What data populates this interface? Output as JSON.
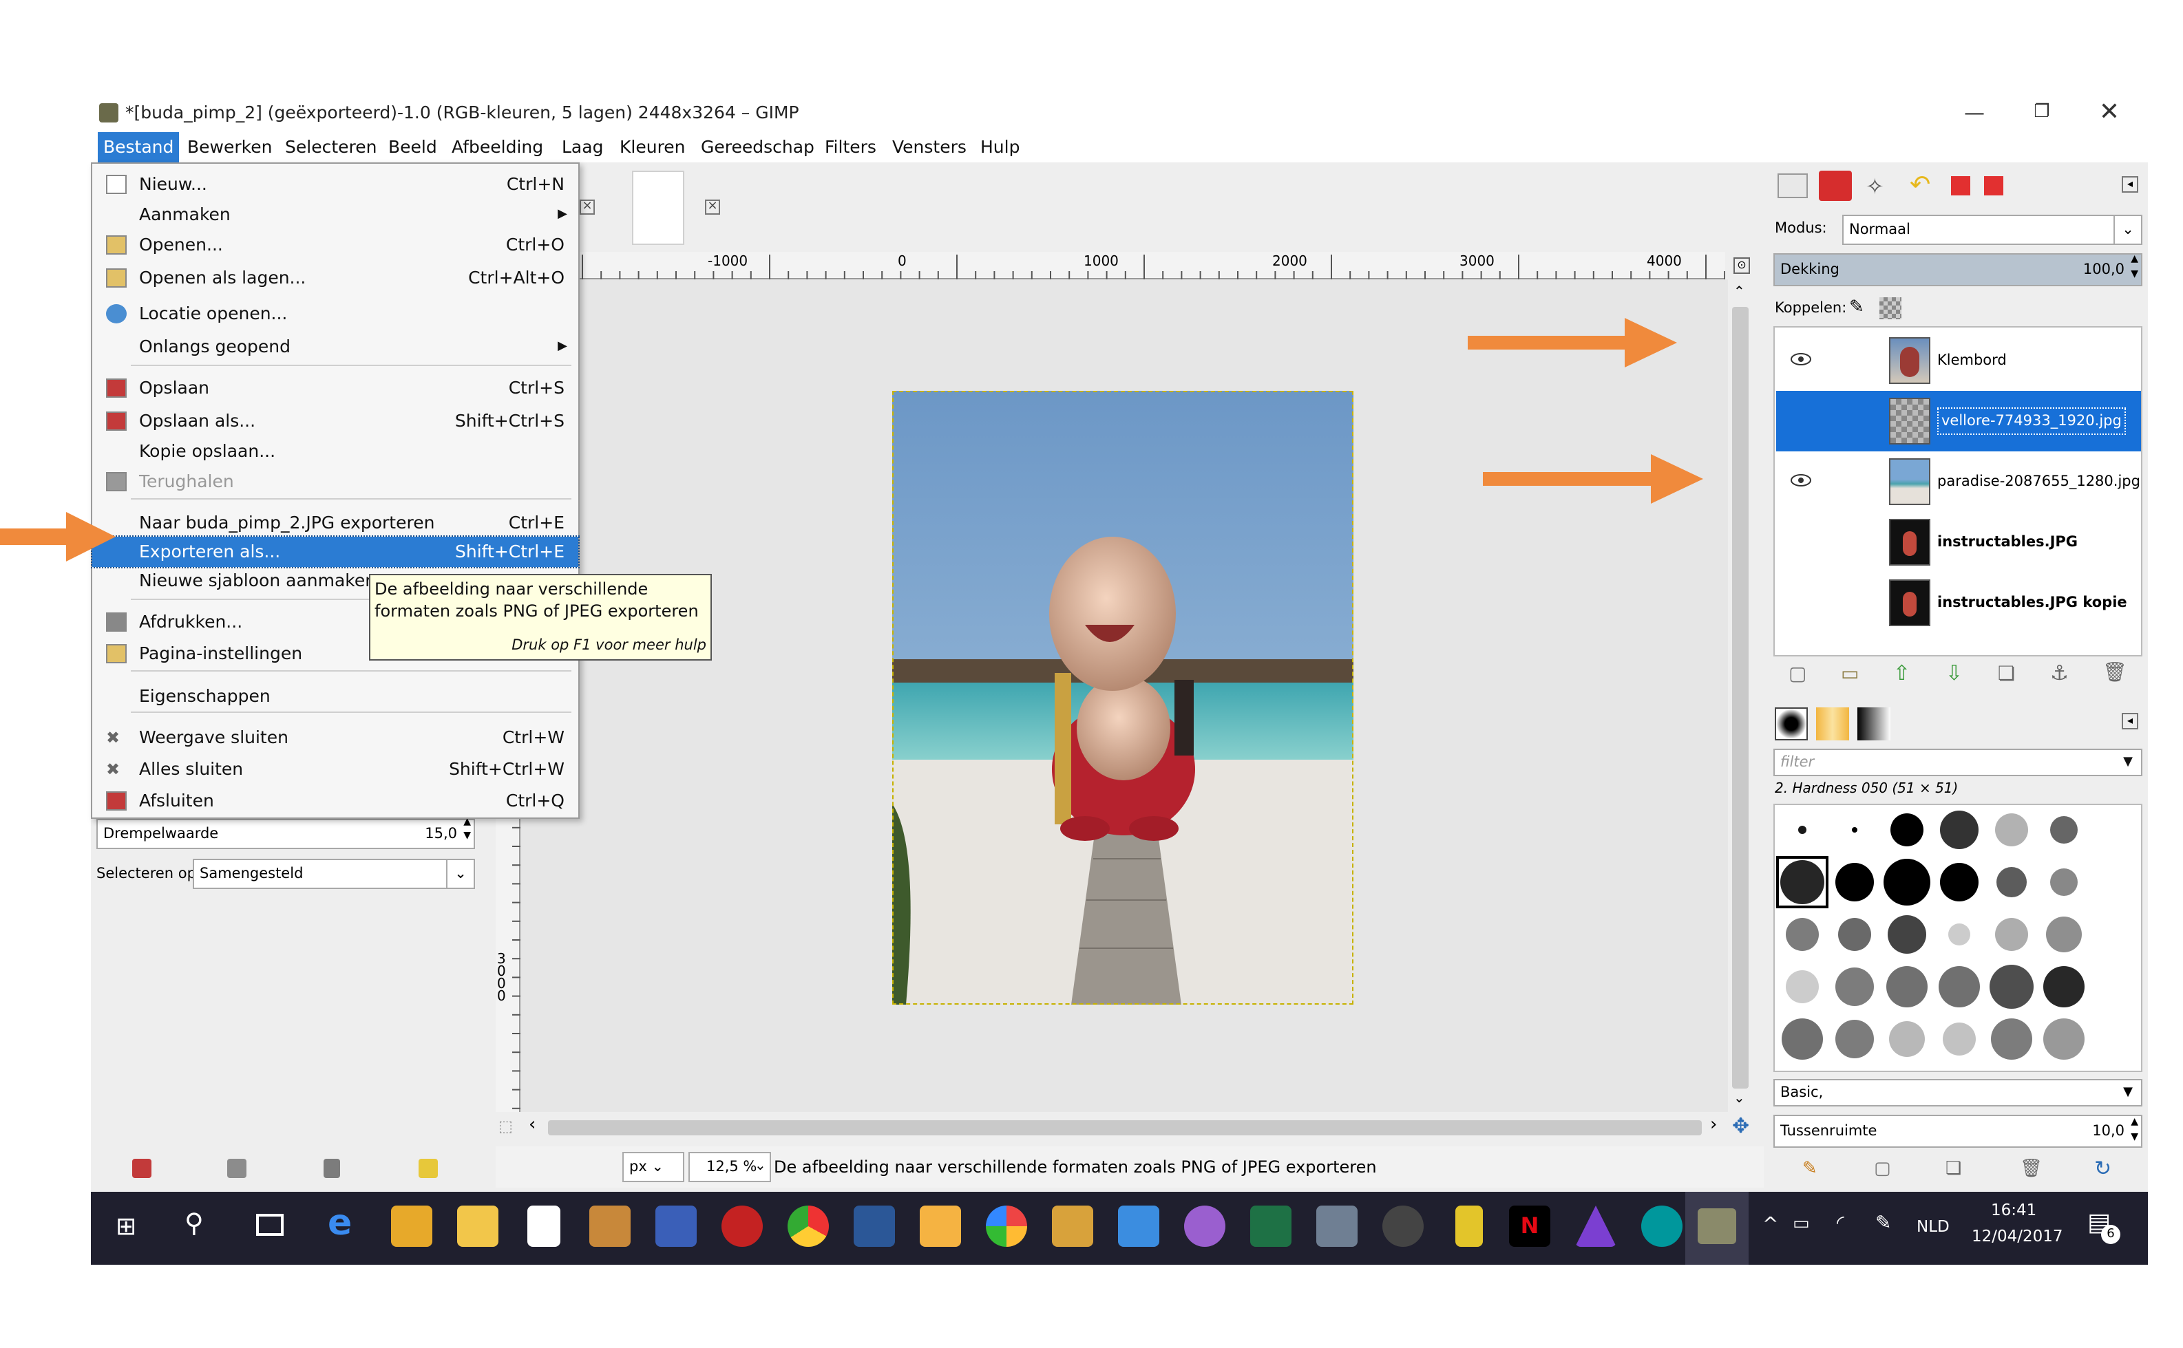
{
  "window": {
    "title": "*[buda_pimp_2] (geëxporteerd)-1.0 (RGB-kleuren, 5 lagen) 2448x3264 – GIMP",
    "minimize_icon": "minimize-icon",
    "maximize_icon": "restore-icon",
    "close_icon": "close-icon"
  },
  "menubar": [
    "Bestand",
    "Bewerken",
    "Selecteren",
    "Beeld",
    "Afbeelding",
    "Laag",
    "Kleuren",
    "Gereedschap",
    "Filters",
    "Vensters",
    "Hulp"
  ],
  "file_menu": [
    {
      "label": "Nieuw...",
      "shortcut": "Ctrl+N",
      "icon": "new-document-icon"
    },
    {
      "label": "Aanmaken",
      "shortcut": "",
      "icon": "",
      "submenu": true
    },
    {
      "label": "Openen...",
      "shortcut": "Ctrl+O",
      "icon": "folder-icon"
    },
    {
      "label": "Openen als lagen...",
      "shortcut": "Ctrl+Alt+O",
      "icon": "open-layers-icon"
    },
    {
      "label": "Locatie openen...",
      "shortcut": "",
      "icon": "globe-icon"
    },
    {
      "label": "Onlangs geopend",
      "shortcut": "",
      "icon": "",
      "submenu": true
    },
    {
      "label": "Opslaan",
      "shortcut": "Ctrl+S",
      "icon": "save-icon"
    },
    {
      "label": "Opslaan als...",
      "shortcut": "Shift+Ctrl+S",
      "icon": "save-as-icon"
    },
    {
      "label": "Kopie opslaan...",
      "shortcut": "",
      "icon": ""
    },
    {
      "label": "Terughalen",
      "shortcut": "",
      "icon": "revert-icon",
      "disabled": true
    },
    {
      "label": "Naar buda_pimp_2.JPG exporteren",
      "shortcut": "Ctrl+E",
      "icon": ""
    },
    {
      "label": "Exporteren als...",
      "shortcut": "Shift+Ctrl+E",
      "icon": "",
      "selected": true
    },
    {
      "label": "Nieuwe sjabloon aanmaken...",
      "shortcut": "",
      "icon": ""
    },
    {
      "label": "Afdrukken...",
      "shortcut": "",
      "icon": "printer-icon"
    },
    {
      "label": "Pagina-instellingen",
      "shortcut": "",
      "icon": "page-setup-icon"
    },
    {
      "label": "Eigenschappen",
      "shortcut": "",
      "icon": ""
    },
    {
      "label": "Weergave sluiten",
      "shortcut": "Ctrl+W",
      "icon": "close-x-icon"
    },
    {
      "label": "Alles sluiten",
      "shortcut": "Shift+Ctrl+W",
      "icon": "close-x-icon"
    },
    {
      "label": "Afsluiten",
      "shortcut": "Ctrl+Q",
      "icon": "quit-icon"
    }
  ],
  "tooltip": {
    "text": "De afbeelding naar verschillende formaten zoals PNG of JPEG exporteren",
    "hint": "Druk op F1 voor meer hulp"
  },
  "tool_options": {
    "threshold_label": "Drempelwaarde",
    "threshold_value": "15,0",
    "select_by_label": "Selecteren op:",
    "select_by_value": "Samengesteld"
  },
  "ruler": {
    "h_labels": [
      "-1000",
      "0",
      "1000",
      "2000",
      "3000",
      "4000"
    ],
    "v_label": "3000"
  },
  "statusbar": {
    "unit": "px",
    "zoom": "12,5 %",
    "message": "De afbeelding naar verschillende formaten zoals PNG of JPEG exporteren"
  },
  "layers_panel": {
    "mode_label": "Modus:",
    "mode_value": "Normaal",
    "opacity_label": "Dekking",
    "opacity_value": "100,0",
    "lock_label": "Koppelen:",
    "layers": [
      {
        "name": "Klembord",
        "visible": true,
        "selected": false,
        "bold": false
      },
      {
        "name": "vellore-774933_1920.jpg",
        "visible": false,
        "selected": true,
        "bold": false
      },
      {
        "name": "paradise-2087655_1280.jpg",
        "visible": true,
        "selected": false,
        "bold": false
      },
      {
        "name": "instructables.JPG",
        "visible": false,
        "selected": false,
        "bold": true
      },
      {
        "name": "instructables.JPG kopie",
        "visible": false,
        "selected": false,
        "bold": true
      }
    ]
  },
  "brushes_panel": {
    "filter_placeholder": "filter",
    "brush_name": "2. Hardness 050 (51 × 51)",
    "preset": "Basic,",
    "spacing_label": "Tussenruimte",
    "spacing_value": "10,0"
  },
  "taskbar": {
    "language": "NLD",
    "time": "16:41",
    "date": "12/04/2017",
    "notifications": "6"
  },
  "colors": {
    "accent": "#2b7cd3",
    "layer_selected": "#1770d8",
    "annotation_arrow": "#f08a3c",
    "taskbar": "#1f1f2e"
  }
}
